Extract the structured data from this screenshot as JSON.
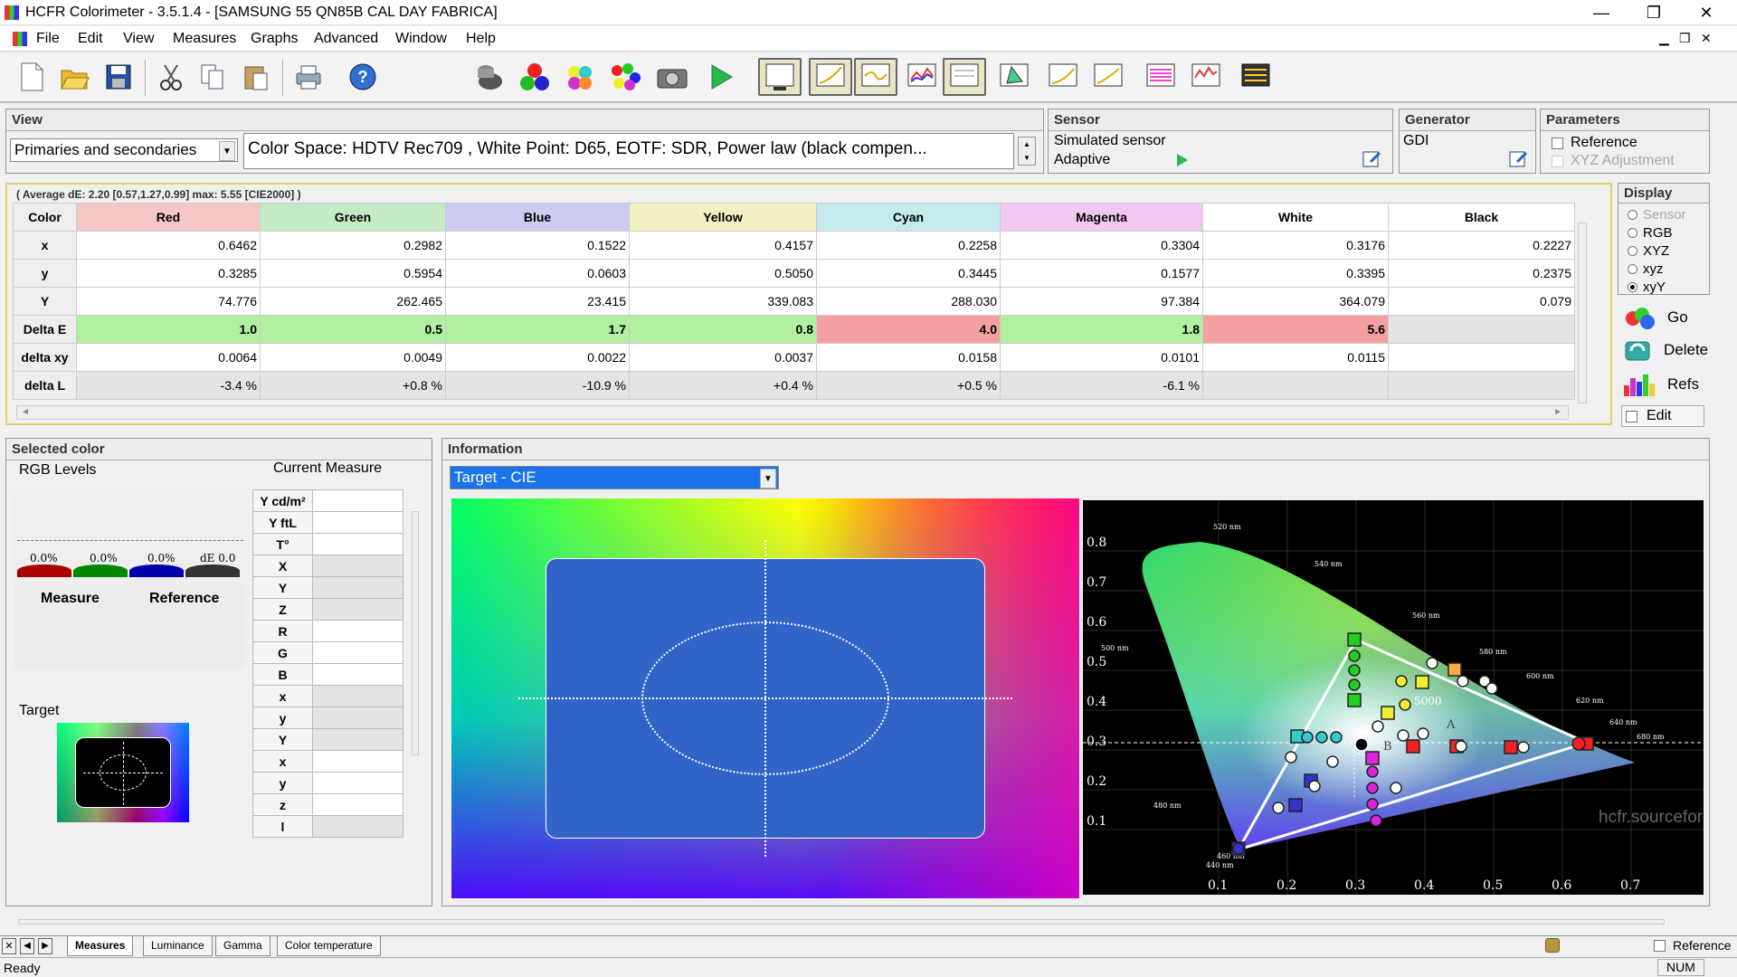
{
  "window": {
    "title": "HCFR Colorimeter - 3.5.1.4 - [SAMSUNG 55 QN85B CAL DAY FABRICA]",
    "min": "—",
    "restore": "❐",
    "close": "✕"
  },
  "menu": [
    "File",
    "Edit",
    "View",
    "Measures",
    "Graphs",
    "Advanced",
    "Window",
    "Help"
  ],
  "view_panel": {
    "title": "View",
    "selected": "Primaries and secondaries",
    "colorspace": "Color Space: HDTV Rec709 , White Point: D65, EOTF:  SDR, Power law (black compen..."
  },
  "sensor_panel": {
    "title": "Sensor",
    "line1": "Simulated sensor",
    "line2": "Adaptive"
  },
  "generator_panel": {
    "title": "Generator",
    "value": "GDI"
  },
  "parameters_panel": {
    "title": "Parameters",
    "reference": "Reference",
    "xyz_adjustment": "XYZ Adjustment"
  },
  "summary": "( Average dE: 2.20 [0.57,1.27,0.99] max: 5.55 [CIE2000] )",
  "table": {
    "headers": [
      "Color",
      "Red",
      "Green",
      "Blue",
      "Yellow",
      "Cyan",
      "Magenta",
      "White",
      "Black"
    ],
    "rows": [
      {
        "label": "x",
        "values": [
          "0.6462",
          "0.2982",
          "0.1522",
          "0.4157",
          "0.2258",
          "0.3304",
          "0.3176",
          "0.2227"
        ]
      },
      {
        "label": "y",
        "values": [
          "0.3285",
          "0.5954",
          "0.0603",
          "0.5050",
          "0.3445",
          "0.1577",
          "0.3395",
          "0.2375"
        ]
      },
      {
        "label": "Y",
        "values": [
          "74.776",
          "262.465",
          "23.415",
          "339.083",
          "288.030",
          "97.384",
          "364.079",
          "0.079"
        ]
      },
      {
        "label": "Delta E",
        "values": [
          "1.0",
          "0.5",
          "1.7",
          "0.8",
          "4.0",
          "1.8",
          "5.6",
          ""
        ]
      },
      {
        "label": "delta xy",
        "values": [
          "0.0064",
          "0.0049",
          "0.0022",
          "0.0037",
          "0.0158",
          "0.0101",
          "0.0115",
          ""
        ]
      },
      {
        "label": "delta L",
        "values": [
          "-3.4 %",
          "+0.8 %",
          "-10.9 %",
          "+0.4 %",
          "+0.5 %",
          "-6.1 %",
          "",
          ""
        ]
      }
    ]
  },
  "display_panel": {
    "title": "Display",
    "options": [
      "Sensor",
      "RGB",
      "XYZ",
      "xyz",
      "xyY"
    ],
    "selected": "xyY"
  },
  "side_buttons": {
    "go": "Go",
    "delete": "Delete",
    "refs": "Refs",
    "edit": "Edit"
  },
  "selected_color": {
    "title": "Selected color",
    "rgb_levels": "RGB Levels",
    "current_measure": "Current Measure",
    "levels": [
      "0.0%",
      "0.0%",
      "0.0%",
      "dE 0.0"
    ],
    "measure": "Measure",
    "reference": "Reference",
    "target": "Target",
    "measure_labels": [
      "Y cd/m²",
      "Y ftL",
      "T°",
      "X",
      "Y",
      "Z",
      "R",
      "G",
      "B",
      "x",
      "y",
      "Y",
      "x",
      "y",
      "z",
      "l"
    ]
  },
  "information": {
    "title": "Information",
    "selected": "Target - CIE"
  },
  "cie": {
    "y_ticks": [
      "0.8",
      "0.7",
      "0.6",
      "0.5",
      "0.4",
      "0.3",
      "0.2",
      "0.1"
    ],
    "x_ticks": [
      "0.1",
      "0.2",
      "0.3",
      "0.4",
      "0.5",
      "0.6",
      "0.7"
    ],
    "wavelengths": [
      "520 nm",
      "540 nm",
      "560 nm",
      "580 nm",
      "600 nm",
      "620 nm",
      "640 nm",
      "680 nm",
      "500 nm",
      "480 nm",
      "460 nm",
      "440 nm"
    ],
    "watermark": "hcfr.sourceforge.net",
    "labels": [
      "A",
      "B",
      "5000"
    ]
  },
  "bottom_tabs": [
    "Measures",
    "Luminance",
    "Gamma",
    "Color temperature"
  ],
  "status": {
    "left": "Ready",
    "num": "NUM",
    "reference": "Reference"
  },
  "colors": {
    "red": "#f4c6c6",
    "green": "#c4ecc4",
    "blue": "#ccccf2",
    "yellow": "#f2f0c2",
    "cyan": "#c4ecec",
    "magenta": "#f2c8f2",
    "good": "#b0f0a0",
    "bad": "#f4a0a0"
  }
}
